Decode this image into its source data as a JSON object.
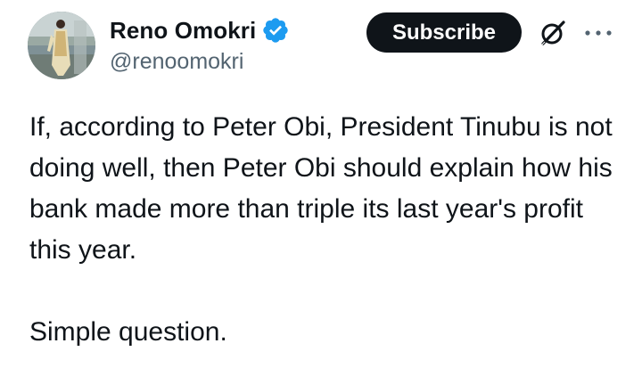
{
  "author": {
    "display_name": "Reno Omokri",
    "handle": "@renoomokri",
    "verified": true
  },
  "actions": {
    "subscribe_label": "Subscribe"
  },
  "icons": {
    "verified": "verified-badge-icon",
    "grok": "grok-icon",
    "more": "more-options-icon"
  },
  "tweet": {
    "paragraphs": [
      "If, according to Peter Obi, President Tinubu is not doing well, then Peter Obi should explain how his bank made more than triple its last year's profit this year.",
      "Simple question."
    ]
  },
  "colors": {
    "text": "#0f1419",
    "secondary": "#536471",
    "verified_blue": "#1d9bf0",
    "button_bg": "#0f1419"
  }
}
